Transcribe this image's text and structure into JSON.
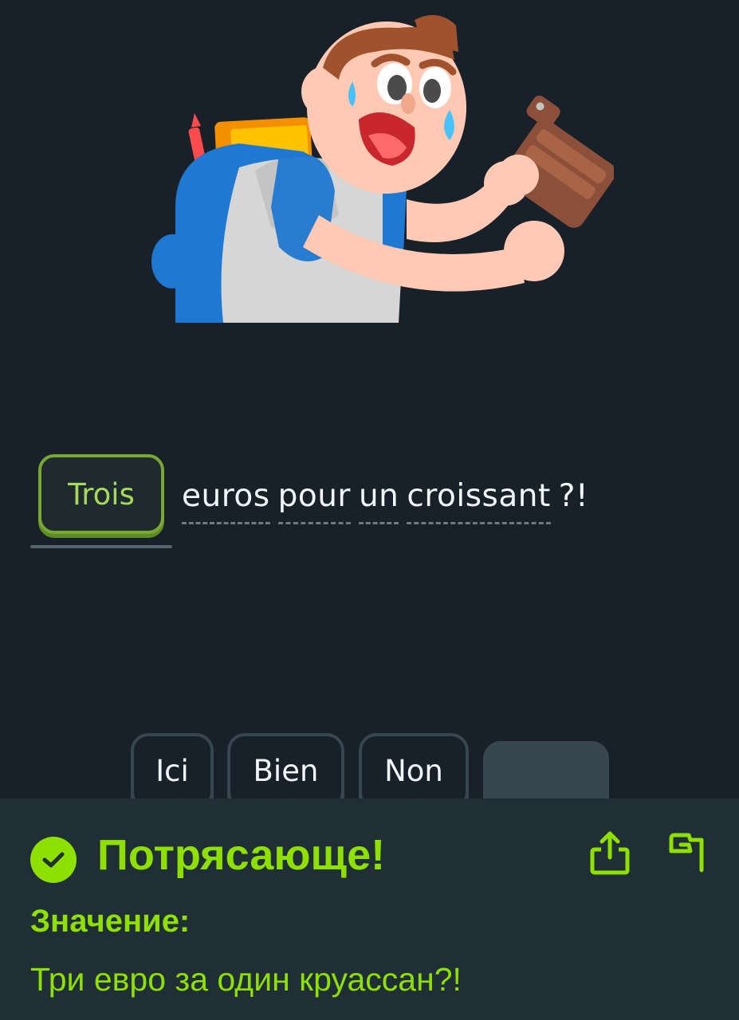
{
  "exercise": {
    "selected_answer": "Trois",
    "sentence_words": [
      "euros",
      "pour",
      "un",
      "croissant"
    ],
    "sentence_end": "?!"
  },
  "word_bank": {
    "options": [
      "Ici",
      "Bien",
      "Non"
    ]
  },
  "feedback": {
    "title": "Потрясающе!",
    "meaning_label": "Значение:",
    "meaning_text": "Три евро за один круассан?!"
  },
  "icons": {
    "status": "check-circle-icon",
    "share": "share-icon",
    "report": "flag-icon"
  },
  "colors": {
    "background": "#18202a",
    "panel": "#202f36",
    "success": "#8ee000",
    "chip_border": "#37464f"
  }
}
